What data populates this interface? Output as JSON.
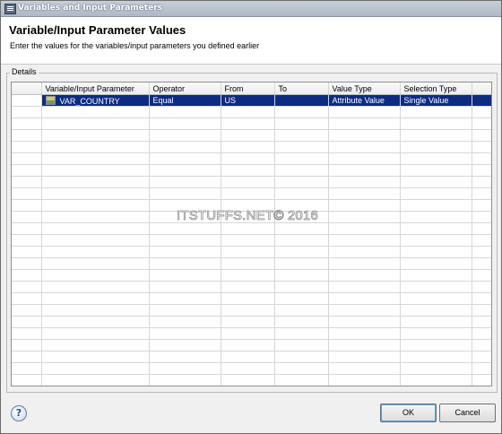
{
  "window": {
    "title": "Variables and Input Parameters"
  },
  "header": {
    "title": "Variable/Input Parameter Values",
    "description": "Enter the values for the variables/input parameters you defined earlier"
  },
  "details": {
    "label": "Details",
    "columns": [
      "",
      "Variable/Input Parameter",
      "Operator",
      "From",
      "To",
      "Value Type",
      "Selection Type",
      ""
    ],
    "rows": [
      {
        "variable": "VAR_COUNTRY",
        "operator": "Equal",
        "from": "US",
        "to": "",
        "value_type": "Attribute Value",
        "selection_type": "Single Value",
        "icon": "variable-icon"
      }
    ],
    "empty_rows": 24
  },
  "watermark": "ITSTUFFS.NET© 2016",
  "buttons": {
    "ok": "OK",
    "cancel": "Cancel",
    "help": "?"
  }
}
